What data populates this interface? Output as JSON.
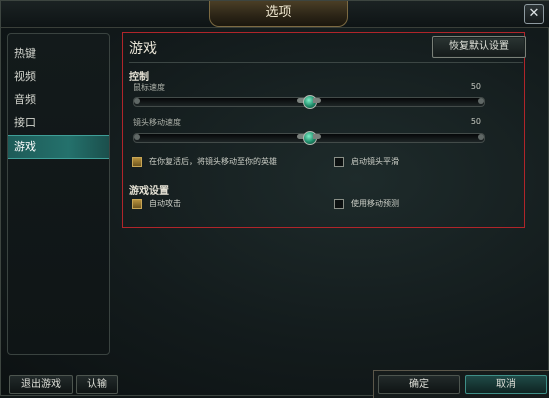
{
  "window": {
    "title": "选项",
    "close_glyph": "✕"
  },
  "sidebar": {
    "items": [
      {
        "label": "热键",
        "active": false
      },
      {
        "label": "视频",
        "active": false
      },
      {
        "label": "音频",
        "active": false
      },
      {
        "label": "接口",
        "active": false
      },
      {
        "label": "游戏",
        "active": true
      }
    ]
  },
  "panel": {
    "title": "游戏",
    "reset_label": "恢复默认设置",
    "control_section": "控制",
    "mouse_speed": {
      "label": "鼠标速度",
      "value": 50
    },
    "camera_speed": {
      "label": "镜头移动速度",
      "value": 50
    },
    "checkboxes_control": [
      {
        "label": "在你复活后，将镜头移动至你的英雄",
        "checked": true
      },
      {
        "label": "启动镜头平滑",
        "checked": false
      }
    ],
    "game_section": "游戏设置",
    "checkboxes_game": [
      {
        "label": "自动攻击",
        "checked": true
      },
      {
        "label": "使用移动预测",
        "checked": false
      }
    ]
  },
  "footer": {
    "exit_label": "退出游戏",
    "surrender_label": "认输",
    "ok_label": "确定",
    "cancel_label": "取消"
  },
  "colors": {
    "accent_teal": "#24716c",
    "highlight_red": "#b0252a",
    "checkbox_gold": "#b7913e"
  }
}
